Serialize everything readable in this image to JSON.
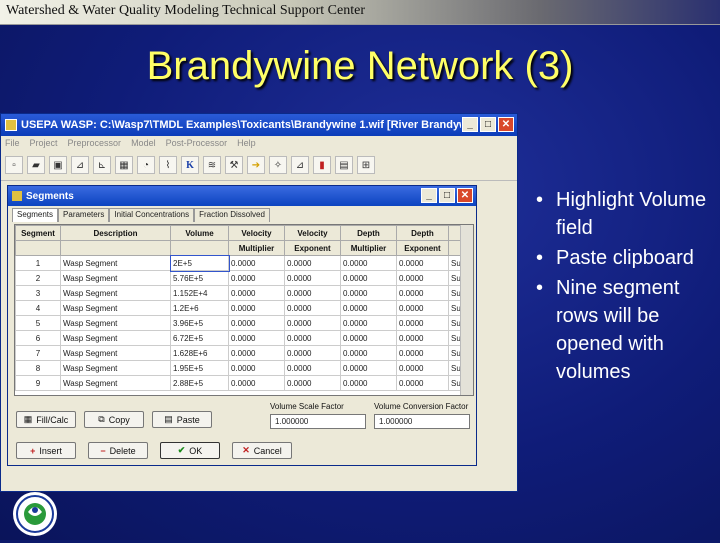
{
  "header": {
    "text": "Watershed & Water Quality Modeling Technical Support Center"
  },
  "slide": {
    "title": "Brandywine Network (3)"
  },
  "app_window": {
    "title": "USEPA WASP: C:\\Wasp7\\TMDL Examples\\Toxicants\\Brandywine 1.wif [River Brandywine, Sim...",
    "menu": [
      "File",
      "Project",
      "Preprocessor",
      "Model",
      "Post-Processor",
      "Help"
    ],
    "toolbar_icons": [
      "new-icon",
      "open-icon",
      "save-icon",
      "chart-icon",
      "graph-icon",
      "grid-icon",
      "clock-icon",
      "plot-icon",
      "k-icon",
      "rate-icon",
      "tools-icon",
      "arrow-icon",
      "wand-icon",
      "graph2-icon",
      "network-icon",
      "data-icon",
      "chart2-icon"
    ]
  },
  "segments_dialog": {
    "title": "Segments",
    "tabs": [
      "Segments",
      "Parameters",
      "Initial Concentrations",
      "Fraction Dissolved"
    ],
    "columns": [
      {
        "top": "Segment",
        "bottom": ""
      },
      {
        "top": "Description",
        "bottom": ""
      },
      {
        "top": "Volume",
        "bottom": ""
      },
      {
        "top": "Velocity",
        "bottom": "Multiplier"
      },
      {
        "top": "Velocity",
        "bottom": "Exponent"
      },
      {
        "top": "Depth",
        "bottom": "Multiplier"
      },
      {
        "top": "Depth",
        "bottom": "Exponent"
      }
    ],
    "rows": [
      [
        "1",
        "Wasp Segment",
        "2E+5",
        "0.0000",
        "0.0000",
        "0.0000",
        "0.0000",
        "Sur"
      ],
      [
        "2",
        "Wasp Segment",
        "5.76E+5",
        "0.0000",
        "0.0000",
        "0.0000",
        "0.0000",
        "Sur"
      ],
      [
        "3",
        "Wasp Segment",
        "1.152E+4",
        "0.0000",
        "0.0000",
        "0.0000",
        "0.0000",
        "Sur"
      ],
      [
        "4",
        "Wasp Segment",
        "1.2E+6",
        "0.0000",
        "0.0000",
        "0.0000",
        "0.0000",
        "Sur"
      ],
      [
        "5",
        "Wasp Segment",
        "3.96E+5",
        "0.0000",
        "0.0000",
        "0.0000",
        "0.0000",
        "Sur"
      ],
      [
        "6",
        "Wasp Segment",
        "6.72E+5",
        "0.0000",
        "0.0000",
        "0.0000",
        "0.0000",
        "Sur"
      ],
      [
        "7",
        "Wasp Segment",
        "1.628E+6",
        "0.0000",
        "0.0000",
        "0.0000",
        "0.0000",
        "Sur"
      ],
      [
        "8",
        "Wasp Segment",
        "1.95E+5",
        "0.0000",
        "0.0000",
        "0.0000",
        "0.0000",
        "Sur"
      ],
      [
        "9",
        "Wasp Segment",
        "2.88E+5",
        "0.0000",
        "0.0000",
        "0.0000",
        "0.0000",
        "Sur"
      ]
    ],
    "buttons": {
      "fill": "Fill/Calc",
      "copy": "Copy",
      "paste": "Paste",
      "insert": "Insert",
      "delete": "Delete",
      "ok": "OK",
      "cancel": "Cancel"
    },
    "volume_scale": {
      "label": "Volume Scale Factor",
      "value": "1.000000"
    },
    "volume_conversion": {
      "label": "Volume Conversion Factor",
      "value": "1.000000"
    }
  },
  "bullets": [
    "Highlight Volume field",
    "Paste clipboard",
    "Nine segment rows will be opened with volumes"
  ]
}
